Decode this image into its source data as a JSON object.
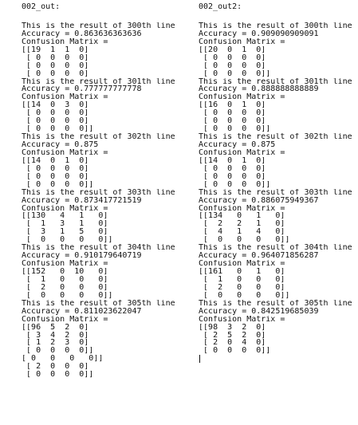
{
  "left": {
    "title": "002_out:",
    "lines": [
      "This is the result of 300th line",
      "Accuracy = 0.863636363636",
      "Confusion Matrix =",
      "[[19  1  1  0]",
      " [ 0  0  0  0]",
      " [ 0  0  0  0]",
      " [ 0  0  0  0]",
      "This is the result of 301th line",
      "Accuracy = 0.777777777778",
      "Confusion Matrix =",
      "[[14  0  3  0]",
      " [ 0  0  0  0]",
      " [ 0  0  0  0]",
      " [ 0  0  0  0]]",
      "This is the result of 302th line",
      "Accuracy = 0.875",
      "Confusion Matrix =",
      "[[14  0  1  0]",
      " [ 0  0  0  0]",
      " [ 0  0  0  0]",
      " [ 0  0  0  0]]",
      "This is the result of 303th line",
      "Accuracy = 0.873417721519",
      "Confusion Matrix =",
      "[[130   4   1   0]",
      " [  1   3   1   0]",
      " [  3   1   5   0]",
      " [  0   0   0   0]]",
      "This is the result of 304th line",
      "Accuracy = 0.910179640719",
      "Confusion Matrix =",
      "[[152   0  10   0]",
      " [  1   0   0   0]",
      " [  2   0   0   0]",
      " [  0   0   0   0]]",
      "This is the result of 305th line",
      "Accuracy = 0.811023622047",
      "Confusion Matrix =",
      "[[96  5  2  0]",
      " [ 3  4  2  0]",
      " [ 1  2  3  0]",
      " [ 0  0  0  0]]",
      "[ 0   0   0   0]]",
      " [ 2  0  0  0]",
      " [ 0  0  0  0]]"
    ]
  },
  "right": {
    "title": "002_out2:",
    "lines": [
      "This is the result of 300th line",
      "Accuracy = 0.909090909091",
      "Confusion Matrix =",
      "[[20  0  1  0]",
      " [ 0  0  0  0]",
      " [ 0  0  0  0]",
      " [ 0  0  0  0]]",
      "This is the result of 301th line",
      "Accuracy = 0.888888888889",
      "Confusion Matrix =",
      "[[16  0  1  0]",
      " [ 0  0  0  0]",
      " [ 0  0  0  0]",
      " [ 0  0  0  0]]",
      "This is the result of 302th line",
      "Accuracy = 0.875",
      "Confusion Matrix =",
      "[[14  0  1  0]",
      " [ 0  0  0  0]",
      " [ 0  0  0  0]",
      " [ 0  0  0  0]]",
      "This is the result of 303th line",
      "Accuracy = 0.886075949367",
      "Confusion Matrix =",
      "[[134   0   1   0]",
      " [  2   2   1   0]",
      " [  4   1   4   0]",
      " [  0   0   0   0]]",
      "This is the result of 304th line",
      "Accuracy = 0.964071856287",
      "Confusion Matrix =",
      "[[161   0   1   0]",
      " [  1   0   0   0]",
      " [  2   0   0   0]",
      " [  0   0   0   0]]",
      "This is the result of 305th line",
      "Accuracy = 0.842519685039",
      "Confusion Matrix =",
      "[[98  3  2  0]",
      " [ 2  5  2  0]",
      " [ 2  0  4  0]",
      " [ 0  0  0  0]]"
    ]
  },
  "underline_color": "#3b6fd4"
}
